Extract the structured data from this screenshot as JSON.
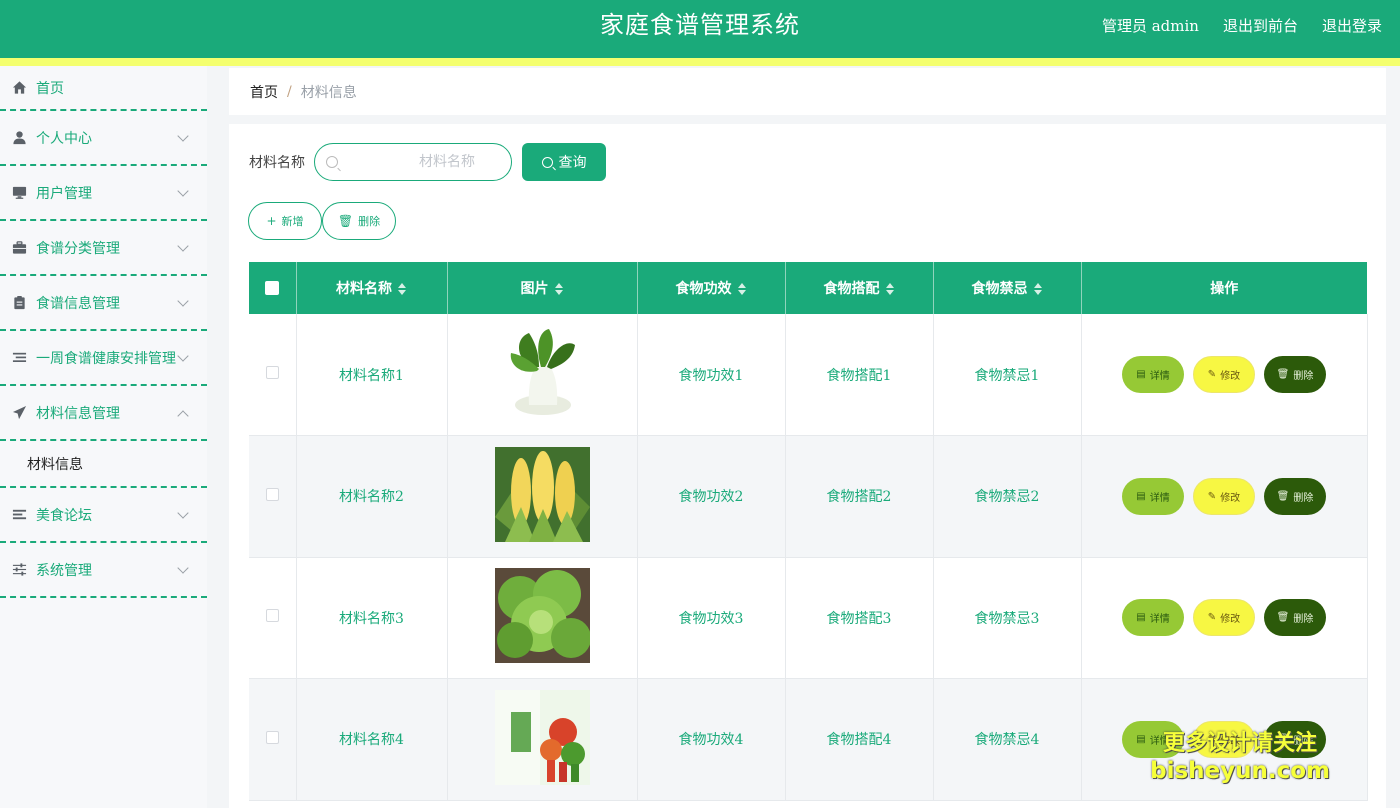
{
  "header": {
    "title": "家庭食谱管理系统",
    "user": "管理员 admin",
    "to_front": "退出到前台",
    "logout": "退出登录"
  },
  "sidebar": {
    "items": [
      {
        "label": "首页",
        "icon": "home-icon",
        "expandable": false
      },
      {
        "label": "个人中心",
        "icon": "user-icon",
        "expandable": true
      },
      {
        "label": "用户管理",
        "icon": "monitor-icon",
        "expandable": true
      },
      {
        "label": "食谱分类管理",
        "icon": "briefcase-icon",
        "expandable": true
      },
      {
        "label": "食谱信息管理",
        "icon": "clipboard-icon",
        "expandable": true
      },
      {
        "label": "一周食谱健康安排管理",
        "icon": "list-icon",
        "expandable": true
      },
      {
        "label": "材料信息管理",
        "icon": "send-icon",
        "expandable": true,
        "expanded": true,
        "children": [
          {
            "label": "材料信息"
          }
        ]
      },
      {
        "label": "美食论坛",
        "icon": "forum-icon",
        "expandable": true
      },
      {
        "label": "系统管理",
        "icon": "sliders-icon",
        "expandable": true
      }
    ]
  },
  "breadcrumb": {
    "home": "首页",
    "separator": "/",
    "current": "材料信息"
  },
  "search": {
    "label": "材料名称",
    "placeholder": "材料名称",
    "button": "查询"
  },
  "actions": {
    "add": "新增",
    "delete": "删除"
  },
  "table": {
    "headers": [
      "材料名称",
      "图片",
      "食物功效",
      "食物搭配",
      "食物禁忌",
      "操作"
    ],
    "rows": [
      {
        "name": "材料名称1",
        "image": "bok-choy",
        "effect": "食物功效1",
        "pairing": "食物搭配1",
        "taboo": "食物禁忌1"
      },
      {
        "name": "材料名称2",
        "image": "corn",
        "effect": "食物功效2",
        "pairing": "食物搭配2",
        "taboo": "食物禁忌2"
      },
      {
        "name": "材料名称3",
        "image": "lettuce",
        "effect": "食物功效3",
        "pairing": "食物搭配3",
        "taboo": "食物禁忌3"
      },
      {
        "name": "材料名称4",
        "image": "vegetables-poster",
        "effect": "食物功效4",
        "pairing": "食物搭配4",
        "taboo": "食物禁忌4"
      }
    ],
    "ops": {
      "detail": "详情",
      "edit": "修改",
      "delete": "删除"
    }
  },
  "watermark": {
    "line1": "更多设计请关注",
    "line2": "bisheyun.com"
  },
  "colors": {
    "primary": "#1aaa7a",
    "stripe": "#f4ff6e",
    "detail": "#96c935",
    "edit": "#f7f743",
    "delete": "#2c5a0a"
  }
}
